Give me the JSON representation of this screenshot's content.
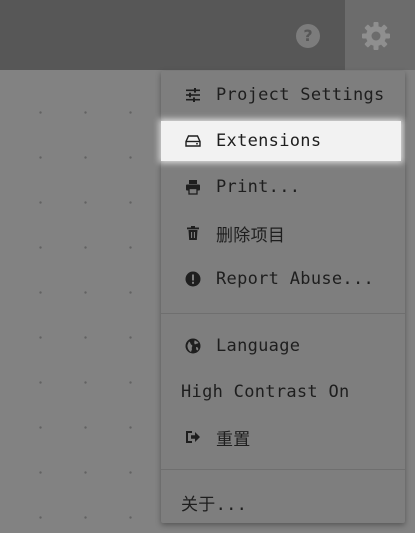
{
  "toolbar": {
    "help_symbol": "?"
  },
  "menu": {
    "items": [
      {
        "label": "Project Settings",
        "icon": "sliders-icon"
      },
      {
        "label": "Extensions",
        "icon": "drive-icon"
      },
      {
        "label": "Print...",
        "icon": "print-icon"
      },
      {
        "label": "删除项目",
        "icon": "trash-icon"
      },
      {
        "label": "Report Abuse...",
        "icon": "exclamation-circle-icon"
      },
      {
        "label": "Language",
        "icon": "globe-icon"
      },
      {
        "label": "High Contrast On"
      },
      {
        "label": "重置",
        "icon": "sign-out-icon"
      },
      {
        "label": "关于..."
      }
    ]
  },
  "colors": {
    "topbar": "#575757",
    "canvas": "#828282",
    "menu": "#7e7e7e",
    "highlight": "#f2f2f2",
    "text": "#1e1e1e"
  }
}
